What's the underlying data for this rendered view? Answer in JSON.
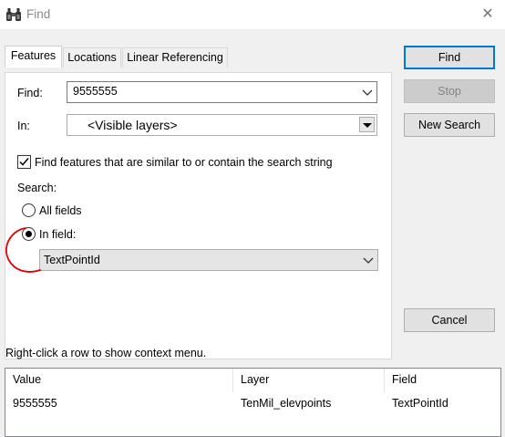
{
  "window": {
    "title": "Find",
    "close_glyph": "✕",
    "icon": "binoculars-icon"
  },
  "tabs": [
    {
      "label": "Features",
      "active": true
    },
    {
      "label": "Locations",
      "active": false
    },
    {
      "label": "Linear Referencing",
      "active": false
    }
  ],
  "features": {
    "find_label": "Find:",
    "find_value": "9555555",
    "in_label": "In:",
    "in_value": "<Visible layers>",
    "similar_checkbox_label": "Find features that are similar to or contain the search string",
    "similar_checked": true,
    "search_label": "Search:",
    "all_fields_label": "All fields",
    "in_field_label": "In field:",
    "selected_search_option": "In field",
    "field_value": "TextPointId"
  },
  "buttons": {
    "find": "Find",
    "stop": "Stop",
    "new_search": "New Search",
    "cancel": "Cancel"
  },
  "context_hint": "Right-click a row to show context menu.",
  "results": {
    "columns": [
      "Value",
      "Layer",
      "Field"
    ],
    "rows": [
      [
        "9555555",
        "TenMil_elevpoints",
        "TextPointId"
      ]
    ]
  },
  "colors": {
    "dialog_background": "#f0f0f0",
    "default_button_border": "#0078d7",
    "annotation_red": "#e00000"
  }
}
